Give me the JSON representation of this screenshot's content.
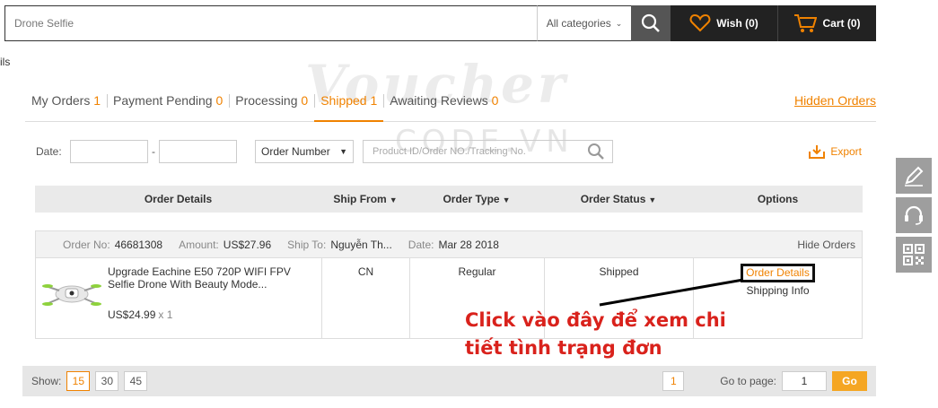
{
  "search": {
    "value": "Drone Selfie",
    "category": "All categories"
  },
  "header": {
    "wish_label": "Wish (0)",
    "cart_label": "Cart (0)"
  },
  "edge_text": "ils",
  "watermark": {
    "word": "Voucher",
    "sub": "CODE.VN"
  },
  "tabs": [
    {
      "label": "My Orders",
      "count": "1"
    },
    {
      "label": "Payment Pending",
      "count": "0"
    },
    {
      "label": "Processing",
      "count": "0"
    },
    {
      "label": "Shipped",
      "count": "1"
    },
    {
      "label": "Awaiting Reviews",
      "count": "0"
    }
  ],
  "hidden_orders": "Hidden Orders",
  "filters": {
    "date_label": "Date:",
    "dash": "-",
    "order_number": "Order Number",
    "product_placeholder": "Product ID/Order NO./Tracking No.",
    "export": "Export"
  },
  "table_headers": {
    "order_details": "Order Details",
    "ship_from": "Ship From",
    "order_type": "Order Type",
    "order_status": "Order Status",
    "options": "Options"
  },
  "order": {
    "order_no_label": "Order No:",
    "order_no": "46681308",
    "amount_label": "Amount:",
    "amount": "US$27.96",
    "ship_to_label": "Ship To:",
    "ship_to": "Nguyễn Th...",
    "date_label": "Date:",
    "date": "Mar 28 2018",
    "hide": "Hide Orders",
    "product_name": "Upgrade Eachine E50 720P WIFI FPV Selfie Drone With Beauty Mode...",
    "price": "US$24.99",
    "qty": "x 1",
    "ship_from": "CN",
    "type": "Regular",
    "status": "Shipped",
    "details_link": "Order Details",
    "shipping_info": "Shipping Info"
  },
  "annotation": {
    "line1": "Click vào đây để xem chi",
    "line2": "tiết tình trạng đơn",
    "color": "#d9221c"
  },
  "pager": {
    "show_label": "Show:",
    "sizes": [
      "15",
      "30",
      "45"
    ],
    "current_page": "1",
    "goto_label": "Go to page:",
    "goto_value": "1",
    "go": "Go"
  },
  "colors": {
    "accent": "#f08200",
    "dark": "#222222"
  },
  "side_icons": [
    "edit-icon",
    "headset-icon",
    "qr-code-icon"
  ]
}
